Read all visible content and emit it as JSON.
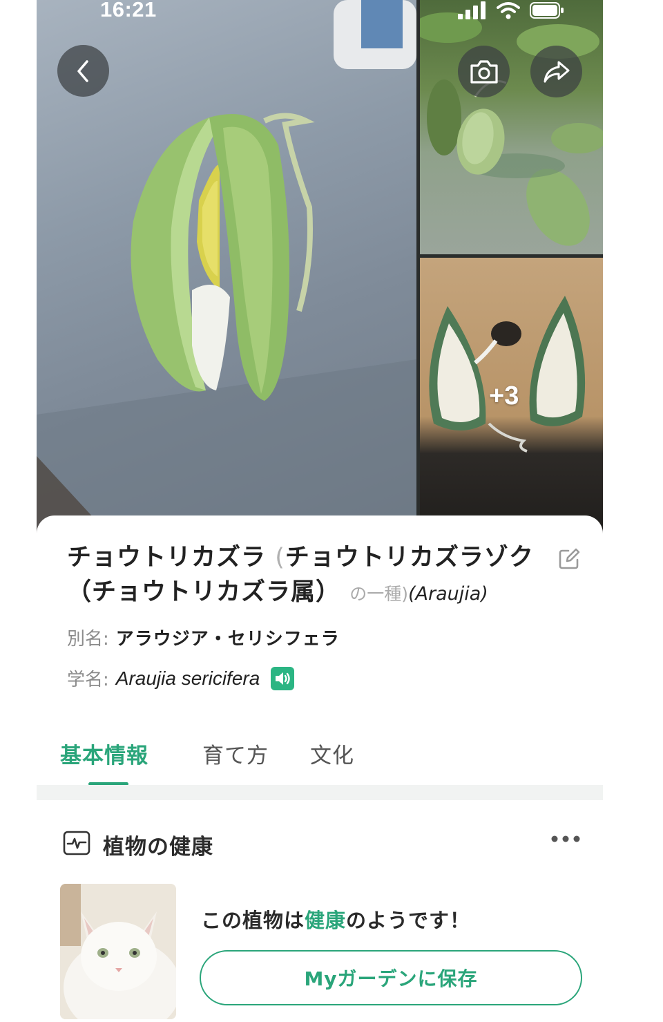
{
  "status_bar": {
    "time": "16:21"
  },
  "gallery": {
    "more_count": "+3"
  },
  "plant": {
    "name": "チョウトリカズラ",
    "paren_open": "(",
    "genus_line": "チョウトリカズラゾク（チョウトリカズラ属）",
    "suffix": "の一種)",
    "latin_genus": "(Araujia)",
    "alias_label": "別名:",
    "alias": "アラウジア・セリシフェラ",
    "sci_label": "学名:",
    "sci_name": "Araujia sericifera"
  },
  "tabs": [
    {
      "label": "基本情報",
      "active": true
    },
    {
      "label": "育て方",
      "active": false
    },
    {
      "label": "文化",
      "active": false
    }
  ],
  "health": {
    "section_title": "植物の健康",
    "status_prefix": "この植物は",
    "status_highlight": "健康",
    "status_suffix": "のようです！",
    "save_button": "Myガーデンに保存"
  },
  "colors": {
    "accent": "#2aa57a",
    "audio": "#2bb583",
    "text": "#222222",
    "muted": "#8b8b8b"
  },
  "icons": [
    "back-icon",
    "camera-icon",
    "share-icon",
    "edit-icon",
    "speaker-icon",
    "health-pulse-icon",
    "more-icon",
    "signal-icon",
    "wifi-icon",
    "battery-icon"
  ]
}
